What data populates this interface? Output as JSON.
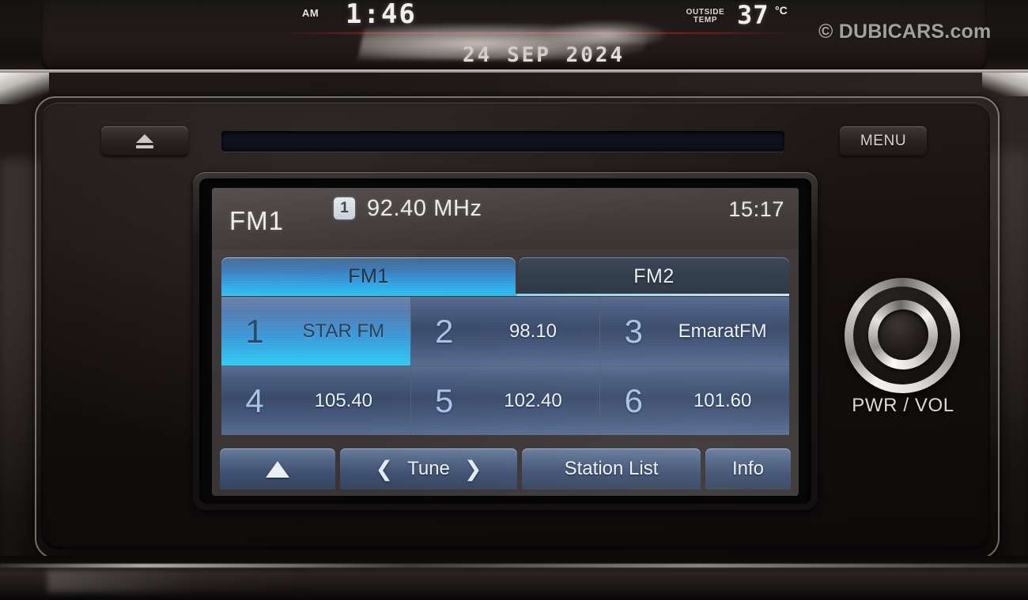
{
  "watermark": "© DUBICARS.com",
  "cluster": {
    "am_label": "AM",
    "time": "1:46",
    "date": "24 SEP 2024",
    "outside_temp_label_line1": "OUTSIDE",
    "outside_temp_label_line2": "TEMP",
    "temperature": "37",
    "temperature_unit": "°C"
  },
  "head_unit": {
    "eject_icon": "eject-icon",
    "menu_label": "MENU",
    "knob_label": "PWR / VOL"
  },
  "screen": {
    "band_label": "FM1",
    "preset_badge": "1",
    "frequency": "92.40 MHz",
    "clock": "15:17",
    "tabs": [
      {
        "label": "FM1",
        "active": true
      },
      {
        "label": "FM2",
        "active": false
      }
    ],
    "presets": [
      {
        "num": "1",
        "value": "STAR FM",
        "selected": true
      },
      {
        "num": "2",
        "value": "98.10",
        "selected": false
      },
      {
        "num": "3",
        "value": "EmaratFM",
        "selected": false
      },
      {
        "num": "4",
        "value": "105.40",
        "selected": false
      },
      {
        "num": "5",
        "value": "102.40",
        "selected": false
      },
      {
        "num": "6",
        "value": "101.60",
        "selected": false
      }
    ],
    "soft_keys": {
      "up_icon": "up-triangle-icon",
      "tune_prev_icon": "❮",
      "tune_label": "Tune",
      "tune_next_icon": "❯",
      "station_list_label": "Station List",
      "info_label": "Info"
    }
  },
  "colors": {
    "accent_cyan": "#35c2f2",
    "tab_active_start": "#4a6b90",
    "preset_cell": "#46597d",
    "lcd_header_bg": "#413b3a",
    "lcd_text": "#f0efed",
    "chrome": "#e6e3df"
  }
}
